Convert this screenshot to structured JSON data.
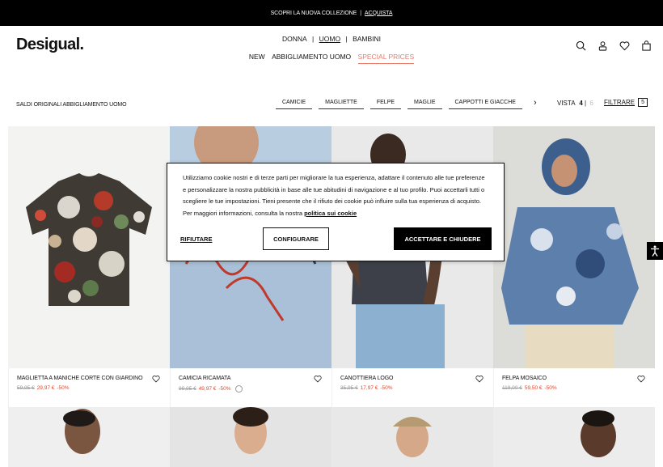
{
  "topbar": {
    "text": "SCOPRI LA NUOVA COLLEZIONE",
    "separator": "|",
    "link": "ACQUISTA"
  },
  "header": {
    "logo": "Desigual.",
    "nav_main": [
      "DONNA",
      "|",
      "UOMO",
      "|",
      "BAMBINI"
    ],
    "nav_sub": [
      "NEW",
      "ABBIGLIAMENTO UOMO",
      "SPECIAL PRICES"
    ],
    "icons": [
      "search-icon",
      "user-icon",
      "heart-icon",
      "bag-icon"
    ]
  },
  "toolbar": {
    "breadcrumb": "SALDI ORIGINALI ABBIGLIAMENTO UOMO",
    "chips": [
      "CAMICIE",
      "MAGLIETTE",
      "FELPE",
      "MAGLIE",
      "CAPPOTTI E GIACCHE"
    ],
    "view_label": "VISTA",
    "view_a": "4",
    "view_sep": "|",
    "view_b": "6",
    "filter_label": "FILTRARE",
    "filter_count": "5"
  },
  "products": [
    {
      "name": "MAGLIETTA A MANICHE CORTE CON GIARDINO",
      "old": "59,95 €",
      "new": "29,97 €",
      "disc": "-50%"
    },
    {
      "name": "CAMICIA RICAMATA",
      "old": "99,95 €",
      "new": "49,97 €",
      "disc": "-50%"
    },
    {
      "name": "CANOTTIERA LOGO",
      "old": "35,95 €",
      "new": "17,97 €",
      "disc": "-50%"
    },
    {
      "name": "FELPA MOSAICO",
      "old": "119,00 €",
      "new": "59,50 €",
      "disc": "-50%"
    }
  ],
  "cookie": {
    "text": "Utilizziamo cookie nostri e di terze parti per migliorare la tua esperienza, adattare il contenuto alle tue preferenze e personalizzare la nostra pubblicità in base alle tue abitudini di navigazione e al tuo profilo. Puoi accettarli tutti o scegliere le tue impostazioni. Tieni presente che il rifiuto dei cookie può influire sulla tua esperienza di acquisto. Per maggiori informazioni, consulta la nostra",
    "link": "politica sui cookie",
    "reject": "RIFIUTARE",
    "configure": "CONFIGURARE",
    "accept": "ACCETTARE E CHIUDERE"
  },
  "colors": {
    "sale": "#e0462b",
    "special": "#e97a68"
  }
}
